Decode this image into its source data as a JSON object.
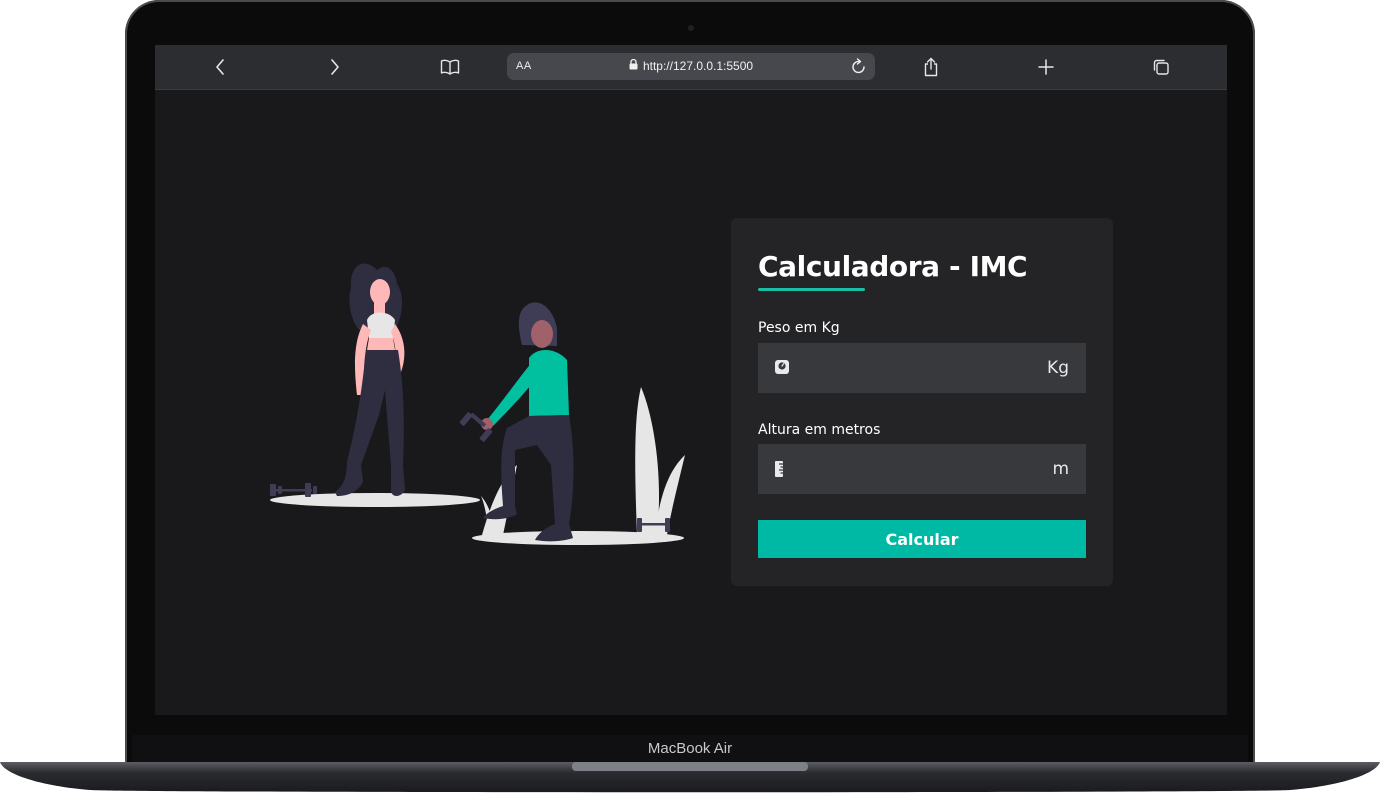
{
  "device": {
    "brand_label": "MacBook Air"
  },
  "browser": {
    "url_aa_label": "AA",
    "url": "http://127.0.0.1:5500",
    "icons": [
      "chevron-left-icon",
      "chevron-right-icon",
      "book-icon",
      "lock-icon",
      "reload-icon",
      "share-icon",
      "plus-icon",
      "tabs-icon"
    ]
  },
  "card": {
    "title": "Calculadora - IMC",
    "weight": {
      "label": "Peso em Kg",
      "unit": "Kg",
      "value": "",
      "icon": "scale-icon"
    },
    "height": {
      "label": "Altura em metros",
      "unit": "m",
      "value": "",
      "icon": "ruler-icon"
    },
    "button_label": "Calcular"
  },
  "colors": {
    "accent": "#00b9a5",
    "background": "#19191b",
    "card": "#242426",
    "input": "#38393d",
    "figure_green": "#00c0a0",
    "skin": "#a0616a",
    "pants": "#2f2e41"
  }
}
